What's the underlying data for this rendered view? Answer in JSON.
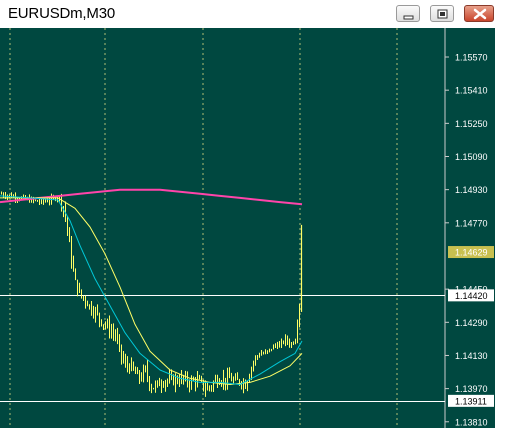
{
  "window": {
    "title": "EURUSDm,M30"
  },
  "colors": {
    "background": "#004840",
    "grid": "#d8d880",
    "candles": "#ffff66",
    "axis_text": "#ffffff",
    "ma_fast": "#00c8d8",
    "ma_slow": "#ffff66",
    "ma_long": "#ff44aa",
    "ma_long_alt": "#ffff66",
    "bid_label_bg": "#c8c050",
    "hline": "#ffffff"
  },
  "icons": [
    "minimize-icon",
    "maximize-icon",
    "close-icon"
  ],
  "chart_data": {
    "type": "candlestick",
    "symbol": "EURUSDm",
    "timeframe": "M30",
    "y_axis_ticks": [
      "1.15570",
      "1.15410",
      "1.15250",
      "1.15090",
      "1.14930",
      "1.14770",
      "1.14450",
      "1.14290",
      "1.14130",
      "1.13970",
      "1.13810"
    ],
    "ylim": [
      1.1378,
      1.1571
    ],
    "current_price_label": "1.14629",
    "horizontal_lines": [
      {
        "label": "1.14420",
        "value": 1.1442
      },
      {
        "label": "1.13911",
        "value": 1.13911
      }
    ],
    "grid": true,
    "close_path": [
      [
        0,
        1.1491
      ],
      [
        10,
        1.149
      ],
      [
        20,
        1.1489
      ],
      [
        30,
        1.1488
      ],
      [
        40,
        1.1487
      ],
      [
        50,
        1.1488
      ],
      [
        58,
        1.149
      ],
      [
        62,
        1.1486
      ],
      [
        66,
        1.1478
      ],
      [
        70,
        1.1462
      ],
      [
        75,
        1.1448
      ],
      [
        80,
        1.1442
      ],
      [
        85,
        1.144
      ],
      [
        90,
        1.1436
      ],
      [
        95,
        1.1434
      ],
      [
        100,
        1.143
      ],
      [
        105,
        1.1428
      ],
      [
        110,
        1.1425
      ],
      [
        115,
        1.1423
      ],
      [
        120,
        1.1414
      ],
      [
        125,
        1.1408
      ],
      [
        130,
        1.1408
      ],
      [
        135,
        1.1404
      ],
      [
        140,
        1.1402
      ],
      [
        145,
        1.1406
      ],
      [
        150,
        1.1398
      ],
      [
        155,
        1.1398
      ],
      [
        160,
        1.14
      ],
      [
        165,
        1.1401
      ],
      [
        170,
        1.1401
      ],
      [
        175,
        1.1401
      ],
      [
        180,
        1.1402
      ],
      [
        185,
        1.1401
      ],
      [
        190,
        1.14
      ],
      [
        195,
        1.1401
      ],
      [
        200,
        1.14
      ],
      [
        205,
        1.1397
      ],
      [
        210,
        1.1398
      ],
      [
        215,
        1.1401
      ],
      [
        220,
        1.1402
      ],
      [
        225,
        1.1401
      ],
      [
        230,
        1.1402
      ],
      [
        235,
        1.14
      ],
      [
        240,
        1.1401
      ],
      [
        245,
        1.1399
      ],
      [
        250,
        1.1406
      ],
      [
        255,
        1.1412
      ],
      [
        260,
        1.1414
      ],
      [
        265,
        1.1414
      ],
      [
        270,
        1.1416
      ],
      [
        275,
        1.1418
      ],
      [
        280,
        1.1418
      ],
      [
        285,
        1.1421
      ],
      [
        290,
        1.1418
      ],
      [
        295,
        1.1421
      ],
      [
        299,
        1.1438
      ],
      [
        302,
        1.1466
      ]
    ],
    "ma_fast_path": [
      [
        0,
        1.149
      ],
      [
        30,
        1.1489
      ],
      [
        58,
        1.1488
      ],
      [
        70,
        1.1478
      ],
      [
        80,
        1.1466
      ],
      [
        95,
        1.145
      ],
      [
        110,
        1.1437
      ],
      [
        125,
        1.1424
      ],
      [
        140,
        1.1414
      ],
      [
        160,
        1.1406
      ],
      [
        180,
        1.1402
      ],
      [
        200,
        1.14
      ],
      [
        220,
        1.14
      ],
      [
        240,
        1.1399
      ],
      [
        260,
        1.1404
      ],
      [
        280,
        1.141
      ],
      [
        295,
        1.1414
      ],
      [
        302,
        1.142
      ]
    ],
    "ma_slow_path": [
      [
        0,
        1.1489
      ],
      [
        30,
        1.1489
      ],
      [
        58,
        1.1489
      ],
      [
        75,
        1.1484
      ],
      [
        90,
        1.1475
      ],
      [
        105,
        1.1462
      ],
      [
        120,
        1.1446
      ],
      [
        135,
        1.1428
      ],
      [
        150,
        1.1415
      ],
      [
        170,
        1.1406
      ],
      [
        190,
        1.1402
      ],
      [
        210,
        1.14
      ],
      [
        230,
        1.1399
      ],
      [
        250,
        1.14
      ],
      [
        270,
        1.1403
      ],
      [
        290,
        1.1408
      ],
      [
        302,
        1.1414
      ]
    ],
    "ma_long_path": [
      [
        0,
        1.1487
      ],
      [
        20,
        1.1488
      ],
      [
        40,
        1.1489
      ],
      [
        60,
        1.149
      ],
      [
        80,
        1.1491
      ],
      [
        100,
        1.1492
      ],
      [
        120,
        1.1493
      ],
      [
        140,
        1.1493
      ],
      [
        160,
        1.1493
      ],
      [
        180,
        1.1492
      ],
      [
        200,
        1.1491
      ],
      [
        220,
        1.149
      ],
      [
        240,
        1.1489
      ],
      [
        260,
        1.1488
      ],
      [
        280,
        1.1487
      ],
      [
        302,
        1.1486
      ]
    ]
  }
}
